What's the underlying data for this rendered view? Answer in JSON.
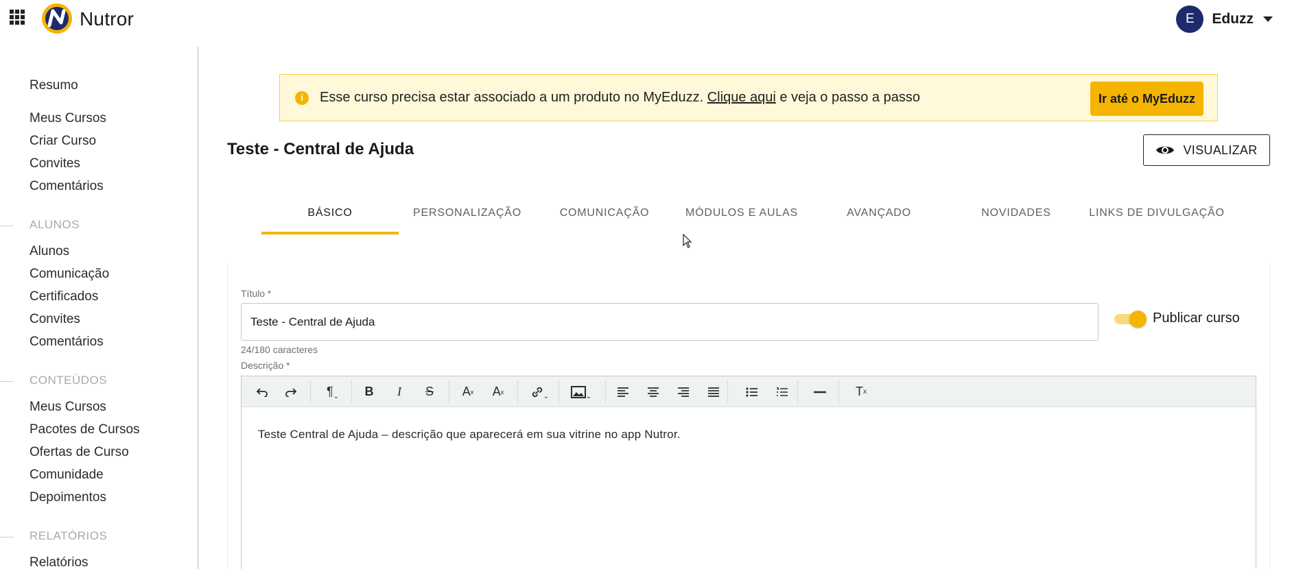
{
  "header": {
    "brand": "Nutror",
    "user": {
      "initial": "E",
      "name": "Eduzz"
    }
  },
  "sidebar": {
    "top_items": [
      "Resumo",
      "Meus Cursos",
      "Criar Curso",
      "Convites",
      "Comentários"
    ],
    "sections": [
      {
        "title": "ALUNOS",
        "items": [
          "Alunos",
          "Comunicação",
          "Certificados",
          "Convites",
          "Comentários"
        ]
      },
      {
        "title": "CONTEÚDOS",
        "items": [
          "Meus Cursos",
          "Pacotes de Cursos",
          "Ofertas de Curso",
          "Comunidade",
          "Depoimentos"
        ]
      },
      {
        "title": "RELATÓRIOS",
        "items": [
          "Relatórios"
        ]
      }
    ]
  },
  "alert": {
    "text_before": "Esse curso precisa estar associado a um produto no MyEduzz.",
    "link": "Clique aqui",
    "text_after": "e veja o passo a passo",
    "button": "Ir até o MyEduzz"
  },
  "page": {
    "title": "Teste - Central de Ajuda",
    "view_button": "VISUALIZAR"
  },
  "tabs": [
    {
      "label": "BÁSICO",
      "active": true
    },
    {
      "label": "PERSONALIZAÇÃO",
      "active": false
    },
    {
      "label": "COMUNICAÇÃO",
      "active": false
    },
    {
      "label": "MÓDULOS E AULAS",
      "active": false
    },
    {
      "label": "AVANÇADO",
      "active": false
    },
    {
      "label": "NOVIDADES",
      "active": false
    },
    {
      "label": "LINKS DE DIVULGAÇÃO",
      "active": false
    }
  ],
  "form": {
    "title_label": "Título *",
    "title_value": "Teste - Central de Ajuda",
    "title_counter": "24/180 caracteres",
    "publish_label": "Publicar curso",
    "publish_on": true,
    "description_label": "Descrição *",
    "description_value": "Teste Central de Ajuda – descrição que aparecerá em sua vitrine no app Nutror."
  },
  "colors": {
    "accent": "#f5b400",
    "alert_bg": "#fff8d9",
    "avatar_bg": "#1d2a6e",
    "toolbar_bg": "#eef3f1"
  }
}
